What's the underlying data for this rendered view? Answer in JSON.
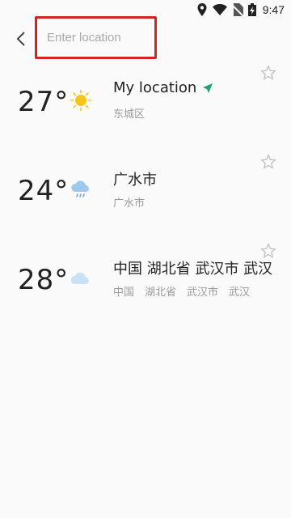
{
  "status_bar": {
    "time": "9:47"
  },
  "search": {
    "placeholder": "Enter location",
    "value": ""
  },
  "locations": [
    {
      "temp": "27°",
      "icon": "sun-icon",
      "title": "My location",
      "subtitle": "东城区",
      "is_current": true
    },
    {
      "temp": "24°",
      "icon": "rain-cloud-icon",
      "title": "广水市",
      "subtitle": "广水市",
      "is_current": false
    },
    {
      "temp": "28°",
      "icon": "cloud-icon",
      "title": "中国 湖北省 武汉市 武汉",
      "subtitle": "中国　湖北省　武汉市　武汉",
      "is_current": false
    }
  ],
  "colors": {
    "accent_green": "#1aa36e",
    "sun": "#f5c518",
    "cloud": "#b9d8f0",
    "highlight_box": "#d32323"
  }
}
